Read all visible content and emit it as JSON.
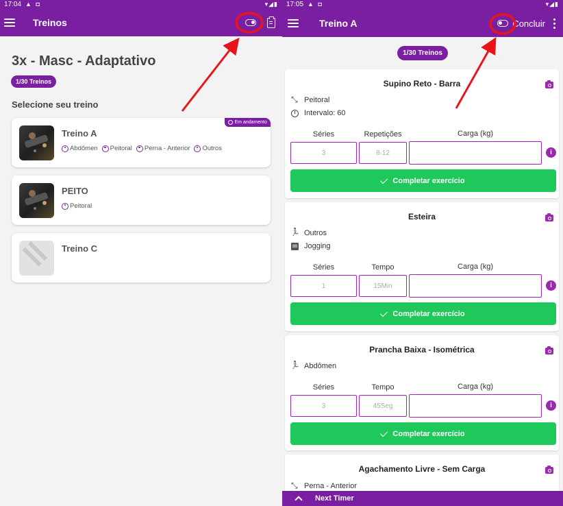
{
  "left_screen": {
    "status_bar": {
      "time": "17:04",
      "alerts": "▲ ◘",
      "right": "▾◢▮"
    },
    "app_bar": {
      "title": "Treinos"
    },
    "program_title": "3x - Masc - Adaptativo",
    "progress_pill": "1/30 Treinos",
    "select_label": "Selecione seu treino",
    "workouts": [
      {
        "name": "Treino A",
        "badge": "Em andamento",
        "thumbnail": "gym-photo",
        "tags": [
          "Abdômen",
          "Peitoral",
          "Perna - Anterior",
          "Outros"
        ]
      },
      {
        "name": "PEITO",
        "thumbnail": "gym-photo",
        "tags": [
          "Peitoral"
        ]
      },
      {
        "name": "Treino C",
        "thumbnail": "placeholder-image",
        "tags": []
      }
    ]
  },
  "right_screen": {
    "status_bar": {
      "time": "17:05",
      "alerts": "▲ ◘",
      "right": "▾◢▮"
    },
    "app_bar": {
      "title": "Treino A",
      "conclude_label": "Concluir"
    },
    "progress_pill": "1/30 Treinos",
    "exercises": [
      {
        "name": "Supino Reto - Barra",
        "info": [
          {
            "icon": "arrows-icon",
            "text": "Peitoral"
          },
          {
            "icon": "timer-icon",
            "text": "Intervalo: 60"
          }
        ],
        "col1_label": "Séries",
        "col1_value": "3",
        "col2_label": "Repetições",
        "col2_value": "8-12",
        "col3_label": "Carga (kg)",
        "col3_value": "",
        "button": "Completar exercício"
      },
      {
        "name": "Esteira",
        "info": [
          {
            "icon": "run-icon",
            "text": "Outros"
          },
          {
            "icon": "chat-icon",
            "text": "Jogging"
          }
        ],
        "col1_label": "Séries",
        "col1_value": "1",
        "col2_label": "Tempo",
        "col2_value": "15Min",
        "col3_label": "Carga (kg)",
        "col3_value": "",
        "button": "Completar exercício"
      },
      {
        "name": "Prancha Baixa - Isométrica",
        "info": [
          {
            "icon": "run-icon",
            "text": "Abdômen"
          }
        ],
        "col1_label": "Séries",
        "col1_value": "3",
        "col2_label": "Tempo",
        "col2_value": "45Seg",
        "col3_label": "Carga (kg)",
        "col3_value": "",
        "button": "Completar exercício"
      },
      {
        "name": "Agachamento Livre - Sem Carga",
        "info": [
          {
            "icon": "arrows-icon",
            "text": "Perna - Anterior"
          }
        ]
      }
    ],
    "next_timer_label": "Next Timer"
  },
  "colors": {
    "primary": "#7b1fa2",
    "accent": "#9c27b0",
    "success": "#1ec85a",
    "annotation": "#e8141a"
  }
}
